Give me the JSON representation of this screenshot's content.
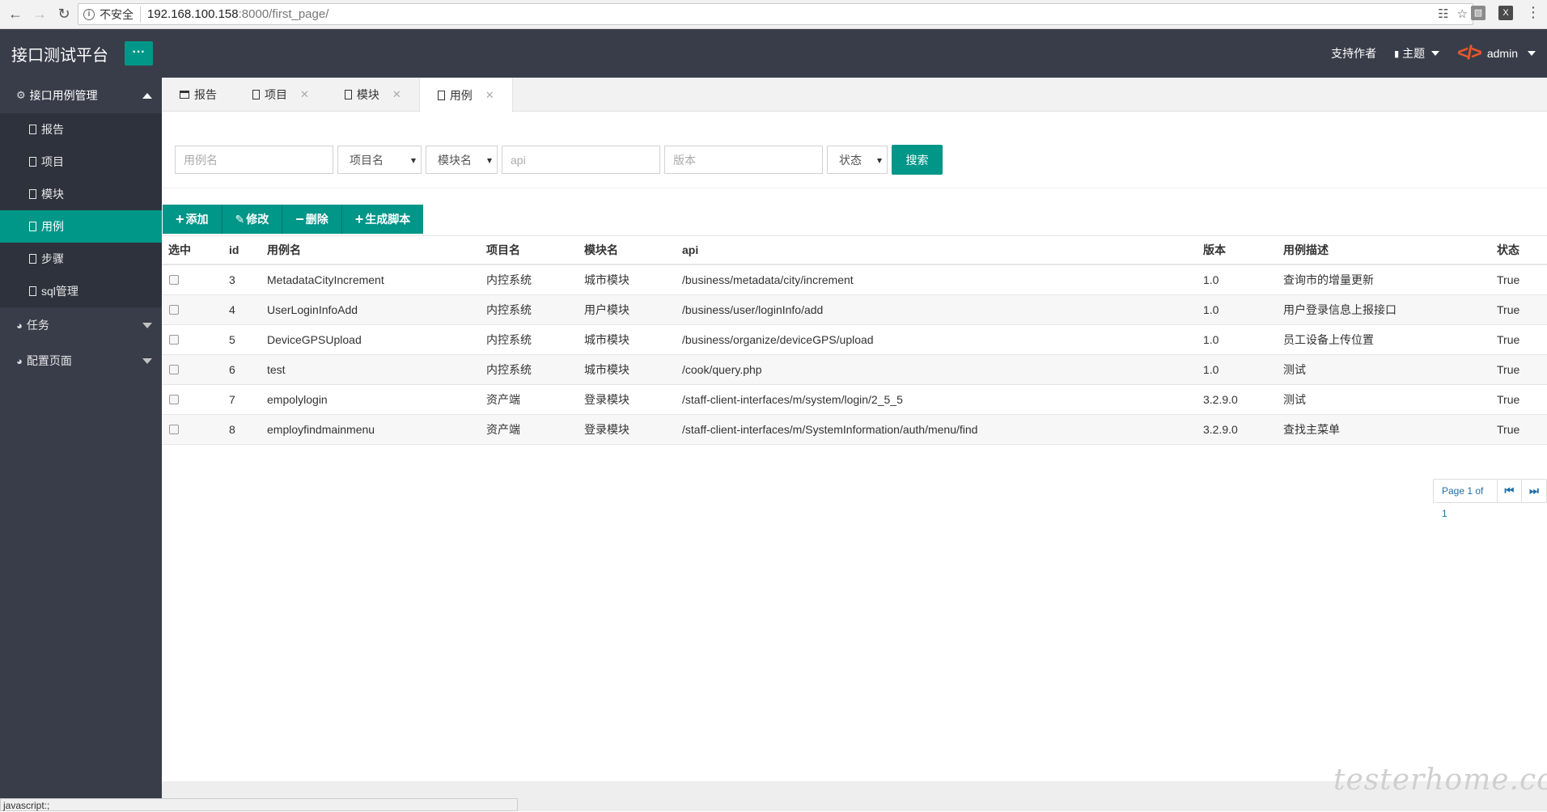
{
  "browser": {
    "insecure_label": "不安全",
    "url_host": "192.168.100.158",
    "url_path": ":8000/first_page/",
    "status_text": "javascript:;"
  },
  "header": {
    "brand": "接口测试平台",
    "menu_toggle": "···",
    "support_author": "支持作者",
    "theme": "主题",
    "logo_glyph": "</>",
    "user": "admin"
  },
  "sidebar": {
    "group_main": "接口用例管理",
    "items": [
      {
        "label": "报告"
      },
      {
        "label": "项目"
      },
      {
        "label": "模块"
      },
      {
        "label": "用例"
      },
      {
        "label": "步骤"
      },
      {
        "label": "sql管理"
      }
    ],
    "group_task": "任务",
    "group_config": "配置页面"
  },
  "tabs": [
    {
      "label": "报告"
    },
    {
      "label": "项目"
    },
    {
      "label": "模块"
    },
    {
      "label": "用例"
    }
  ],
  "search": {
    "case_name_placeholder": "用例名",
    "project_select": "项目名",
    "module_select": "模块名",
    "api_placeholder": "api",
    "version_placeholder": "版本",
    "status_select": "状态",
    "search_button": "搜索"
  },
  "toolbar": {
    "add": "添加",
    "edit": "修改",
    "delete": "删除",
    "generate": "生成脚本"
  },
  "table": {
    "headers": [
      "选中",
      "id",
      "用例名",
      "项目名",
      "模块名",
      "api",
      "版本",
      "用例描述",
      "状态"
    ],
    "rows": [
      {
        "id": "3",
        "name": "MetadataCityIncrement",
        "project": "内控系统",
        "module": "城市模块",
        "api": "/business/metadata/city/increment",
        "version": "1.0",
        "desc": "查询市的增量更新",
        "status": "True"
      },
      {
        "id": "4",
        "name": "UserLoginInfoAdd",
        "project": "内控系统",
        "module": "用户模块",
        "api": "/business/user/loginInfo/add",
        "version": "1.0",
        "desc": "用户登录信息上报接口",
        "status": "True"
      },
      {
        "id": "5",
        "name": "DeviceGPSUpload",
        "project": "内控系统",
        "module": "城市模块",
        "api": "/business/organize/deviceGPS/upload",
        "version": "1.0",
        "desc": "员工设备上传位置",
        "status": "True"
      },
      {
        "id": "6",
        "name": "test",
        "project": "内控系统",
        "module": "城市模块",
        "api": "/cook/query.php",
        "version": "1.0",
        "desc": "测试",
        "status": "True"
      },
      {
        "id": "7",
        "name": "empolylogin",
        "project": "资产端",
        "module": "登录模块",
        "api": "/staff-client-interfaces/m/system/login/2_5_5",
        "version": "3.2.9.0",
        "desc": "测试",
        "status": "True"
      },
      {
        "id": "8",
        "name": "employfindmainmenu",
        "project": "资产端",
        "module": "登录模块",
        "api": "/staff-client-interfaces/m/SystemInformation/auth/menu/find",
        "version": "3.2.9.0",
        "desc": "查找主菜单",
        "status": "True"
      }
    ]
  },
  "pager": {
    "info": "Page 1 of 1",
    "first_glyph": "⏮",
    "last_glyph": "⏭"
  },
  "watermark": "testerhome.com",
  "colors": {
    "accent": "#009688",
    "sidebar_bg": "#393d49",
    "topbar_bg": "#393d49"
  }
}
